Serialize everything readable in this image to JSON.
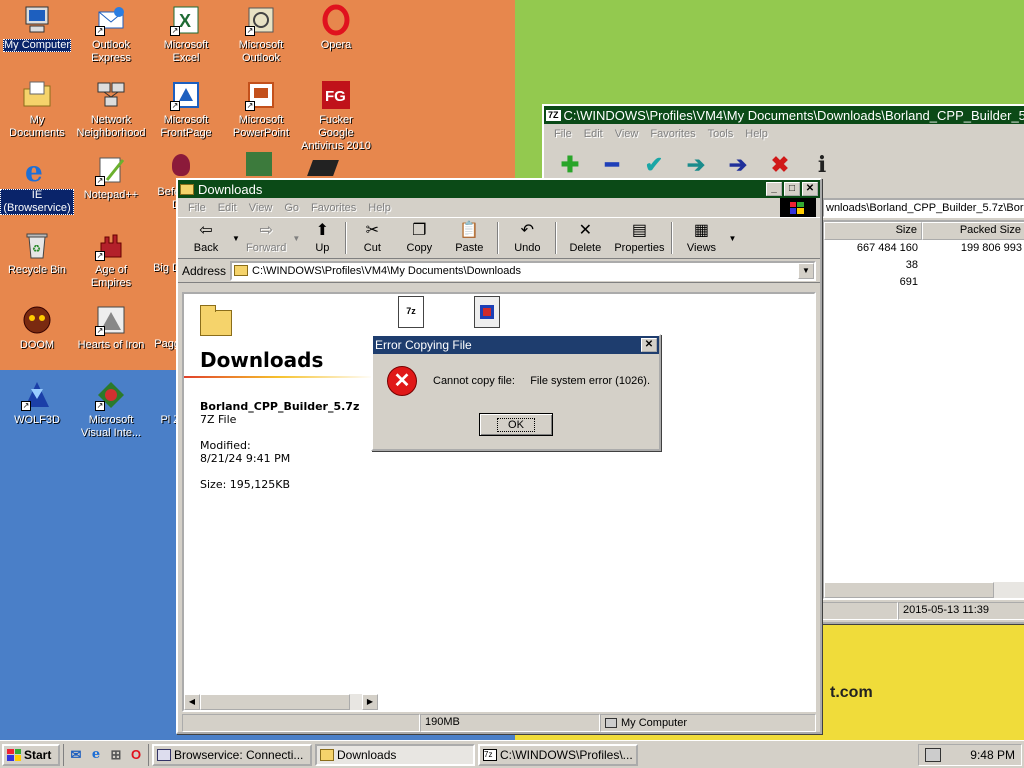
{
  "desktop": {
    "icons": [
      {
        "id": "mycomputer",
        "label": "My Computer"
      },
      {
        "id": "outlookexpress",
        "label": "Outlook Express"
      },
      {
        "id": "excel",
        "label": "Microsoft Excel"
      },
      {
        "id": "outlook",
        "label": "Microsoft Outlook"
      },
      {
        "id": "opera",
        "label": "Opera"
      },
      {
        "id": "mydocuments",
        "label": "My Documents"
      },
      {
        "id": "network",
        "label": "Network Neighborhood"
      },
      {
        "id": "frontpage",
        "label": "Microsoft FrontPage"
      },
      {
        "id": "powerpoint",
        "label": "Microsoft PowerPoint"
      },
      {
        "id": "fuckergoogle",
        "label": "Fucker Google Antivirus 2010"
      },
      {
        "id": "ie",
        "label": "IE (Browservice)"
      },
      {
        "id": "notepadpp",
        "label": "Notepad++"
      },
      {
        "id": "recyclebin",
        "label": "Recycle Bin"
      },
      {
        "id": "ageofempires",
        "label": "Age of Empires"
      },
      {
        "id": "doom",
        "label": "DOOM"
      },
      {
        "id": "heartsofiron",
        "label": "Hearts of Iron"
      },
      {
        "id": "wolf3d",
        "label": "WOLF3D"
      },
      {
        "id": "visualinterdev",
        "label": "Microsoft Visual Inte..."
      }
    ],
    "partial_labels": [
      "Befe D",
      "Big D",
      "Pagg",
      "Pl Z"
    ],
    "wallpaper_text": "t.com"
  },
  "zip_window": {
    "title": "C:\\WINDOWS\\Profiles\\VM4\\My Documents\\Downloads\\Borland_CPP_Builder_5.7z\\",
    "menu": [
      "File",
      "Edit",
      "View",
      "Favorites",
      "Tools",
      "Help"
    ],
    "address": "wnloads\\Borland_CPP_Builder_5.7z\\Borland",
    "columns": [
      "Size",
      "Packed Size"
    ],
    "rows": [
      {
        "size": "667 484 160",
        "packed": "199 806 993"
      },
      {
        "size": "38",
        "packed": ""
      },
      {
        "size": "691",
        "packed": ""
      }
    ],
    "status_date": "2015-05-13 11:39"
  },
  "explorer": {
    "title": "Downloads",
    "menu": [
      "File",
      "Edit",
      "View",
      "Go",
      "Favorites",
      "Help"
    ],
    "toolbar": {
      "back": "Back",
      "forward": "Forward",
      "up": "Up",
      "cut": "Cut",
      "copy": "Copy",
      "paste": "Paste",
      "undo": "Undo",
      "delete": "Delete",
      "properties": "Properties",
      "views": "Views"
    },
    "address_label": "Address",
    "address": "C:\\WINDOWS\\Profiles\\VM4\\My Documents\\Downloads",
    "folder_title": "Downloads",
    "selected_file": "Borland_CPP_Builder_5.7z",
    "file_type": "7Z File",
    "modified_label": "Modified:",
    "modified_value": "8/21/24 9:41 PM",
    "size_text": "Size: 195,125KB",
    "file_icon_label": "7z",
    "status_size": "190MB",
    "status_zone": "My Computer"
  },
  "dialog": {
    "title": "Error Copying File",
    "message": "Cannot copy file:     File system error (1026).",
    "ok": "OK"
  },
  "taskbar": {
    "start": "Start",
    "buttons": [
      {
        "label": "Browservice: Connecti..."
      },
      {
        "label": "Downloads"
      },
      {
        "label": "C:\\WINDOWS\\Profiles\\..."
      }
    ],
    "clock": "9:48 PM"
  }
}
